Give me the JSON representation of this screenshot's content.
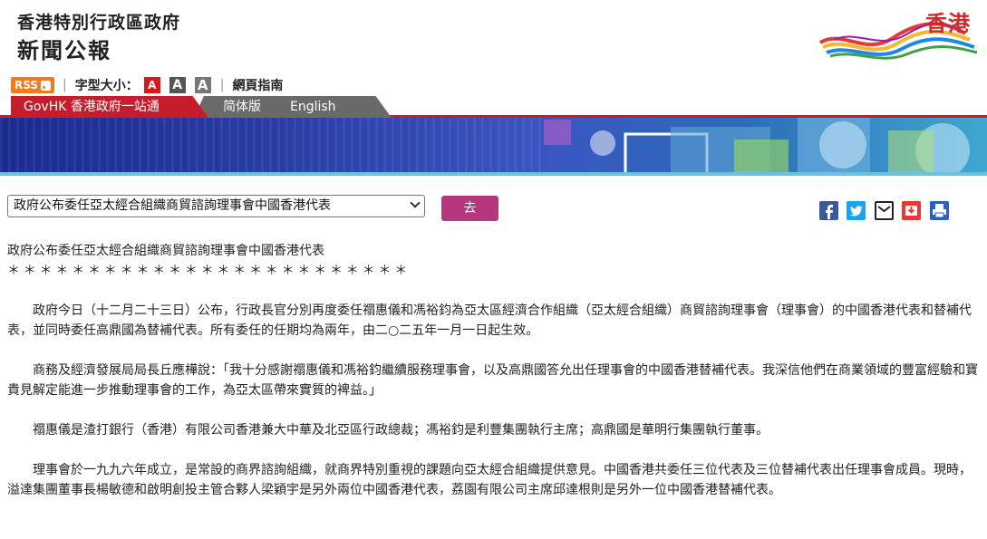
{
  "header": {
    "site_title": "香港特別行政區政府",
    "site_subtitle": "新聞公報",
    "brand_text": "香港"
  },
  "toolbar": {
    "rss_label": "RSS",
    "font_size_label": "字型大小：",
    "font_size_options": [
      "A",
      "A",
      "A"
    ],
    "sitemap_label": "網頁指南"
  },
  "nav": {
    "govhk_label": "GovHK 香港政府一站通",
    "simplified_label": "简体版",
    "english_label": "English"
  },
  "selector": {
    "selected_value": "政府公布委任亞太經合組織商貿諮詢理事會中國香港代表",
    "go_label": "去"
  },
  "share": {
    "icons": [
      "facebook-icon",
      "twitter-icon",
      "email-icon",
      "save-icon",
      "print-icon"
    ]
  },
  "article": {
    "title": "政府公布委任亞太經合組織商貿諮詢理事會中國香港代表",
    "stars": "＊＊＊＊＊＊＊＊＊＊＊＊＊＊＊＊＊＊＊＊＊＊＊＊＊",
    "paragraphs": [
      "政府今日（十二月二十三日）公布，行政長官分別再度委任禤惠儀和馮裕鈞為亞太區經濟合作組織（亞太經合組織）商貿諮詢理事會（理事會）的中國香港代表和替補代表，並同時委任高鼎國為替補代表。所有委任的任期均為兩年，由二○二五年一月一日起生效。",
      "商務及經濟發展局局長丘應樺說：「我十分感謝禤惠儀和馮裕鈞繼續服務理事會，以及高鼎國答允出任理事會的中國香港替補代表。我深信他們在商業領域的豐富經驗和寶貴見解定能進一步推動理事會的工作，為亞太區帶來實質的裨益。」",
      "禤惠儀是渣打銀行（香港）有限公司香港兼大中華及北亞區行政總裁；馮裕鈞是利豐集團執行主席；高鼎國是華明行集團執行董事。",
      "理事會於一九九六年成立，是常設的商界諮詢組織，就商界特別重視的課題向亞太經合組織提供意見。中國香港共委任三位代表及三位替補代表出任理事會成員。現時，溢達集團董事長楊敏德和啟明創投主管合夥人梁穎宇是另外兩位中國香港代表，荔園有限公司主席邱達根則是另外一位中國香港替補代表。"
    ]
  },
  "colors": {
    "accent_red": "#c51d2c",
    "go_button": "#b5387f",
    "rss_orange": "#ef7b1a"
  }
}
